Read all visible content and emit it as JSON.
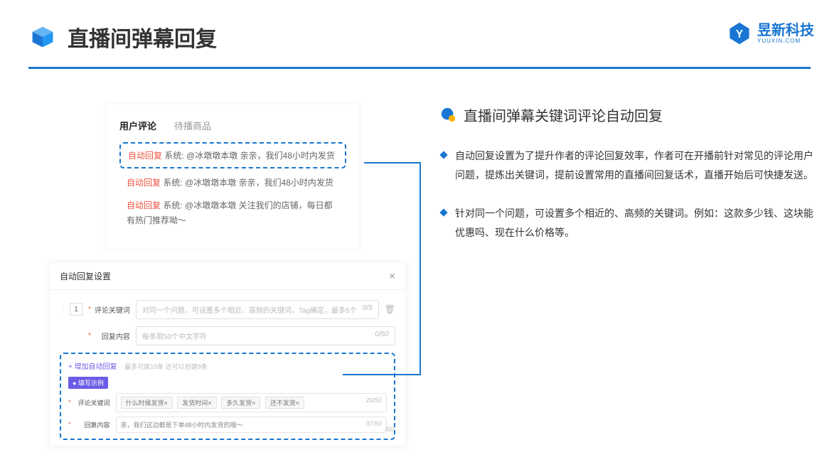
{
  "header": {
    "title": "直播间弹幕回复"
  },
  "brand": {
    "name": "昱新科技",
    "sub": "YUUXIN.COM"
  },
  "card1": {
    "tab1": "用户评论",
    "tab2": "待播商品",
    "highlight_tag": "自动回复",
    "highlight_sys": "系统:",
    "highlight_text": "@冰墩墩本墩 亲亲，我们48小时内发货",
    "r2_tag": "自动回复",
    "r2_sys": "系统:",
    "r2_text": "@冰墩墩本墩 亲亲，我们48小时内发货",
    "r3_tag": "自动回复",
    "r3_sys": "系统:",
    "r3_text": "@冰墩墩本墩 关注我们的店铺，每日都有热门推荐呦～"
  },
  "card2": {
    "title": "自动回复设置",
    "num": "1",
    "kw_label": "评论关键词",
    "kw_placeholder": "对同一个问题，可设置多个相近、高频的关键词，Tag确定，最多5个",
    "kw_counter": "0/5",
    "rc_label": "回复内容",
    "rc_placeholder": "每条限50个中文字符",
    "rc_counter": "0/50",
    "add_link": "+ 增加自动回复",
    "add_hint": "最多可建10条 还可以创建9条",
    "example_badge": "● 填写示例",
    "ex_kw_label": "评论关键词",
    "ex_kw_counter": "20/50",
    "tag1": "什么时候发货×",
    "tag2": "发货时间×",
    "tag3": "多久发货×",
    "tag4": "还不发货×",
    "ex_rc_label": "回复内容",
    "ex_rc_text": "亲，我们这边都是下单48小时内发货的哦～",
    "ex_rc_counter": "37/50",
    "outside_counter": "/50"
  },
  "right": {
    "title": "直播间弹幕关键词评论自动回复",
    "b1": "自动回复设置为了提升作者的评论回复效率，作者可在开播前针对常见的评论用户问题，提炼出关键词，提前设置常用的直播间回复话术，直播开始后可快捷发送。",
    "b2": "针对同一个问题，可设置多个相近的、高频的关键词。例如：这款多少钱、这块能优惠吗、现在什么价格等。"
  }
}
